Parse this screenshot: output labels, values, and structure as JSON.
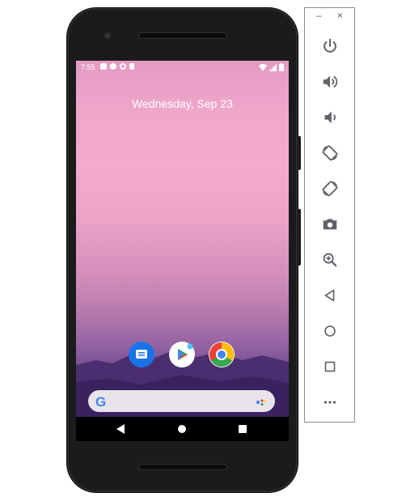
{
  "status_bar": {
    "time": "7:55",
    "left_icons": [
      "notification-a-icon",
      "notification-b-icon",
      "shield-icon",
      "sd-card-icon"
    ],
    "right_icons": [
      "wifi-icon",
      "cellular-icon",
      "battery-icon"
    ]
  },
  "lockscreen": {
    "date": "Wednesday, Sep 23"
  },
  "dock": {
    "apps": [
      {
        "name": "Messages",
        "icon": "messages-icon",
        "color": "#1a73e8"
      },
      {
        "name": "Play Store",
        "icon": "play-store-icon",
        "color": "#ffffff"
      },
      {
        "name": "Chrome",
        "icon": "chrome-icon",
        "color": "#ea4335"
      }
    ]
  },
  "search_bar": {
    "logo": "G",
    "icons": [
      "google-icon",
      "assistant-icon"
    ]
  },
  "nav_bar": {
    "buttons": [
      "back-icon",
      "home-icon",
      "recents-icon"
    ]
  },
  "emulator_toolbar": {
    "window_controls": {
      "minimize": "–",
      "close": "×"
    },
    "buttons": [
      {
        "name": "power",
        "icon": "power-icon"
      },
      {
        "name": "volume-up",
        "icon": "volume-up-icon"
      },
      {
        "name": "volume-down",
        "icon": "volume-down-icon"
      },
      {
        "name": "rotate-left",
        "icon": "rotate-left-icon"
      },
      {
        "name": "rotate-right",
        "icon": "rotate-right-icon"
      },
      {
        "name": "screenshot",
        "icon": "camera-icon"
      },
      {
        "name": "zoom",
        "icon": "zoom-in-icon"
      },
      {
        "name": "back",
        "icon": "back-icon"
      },
      {
        "name": "home",
        "icon": "home-icon"
      },
      {
        "name": "overview",
        "icon": "overview-icon"
      },
      {
        "name": "more",
        "icon": "more-icon"
      }
    ],
    "icon_color": "#5f6368"
  }
}
